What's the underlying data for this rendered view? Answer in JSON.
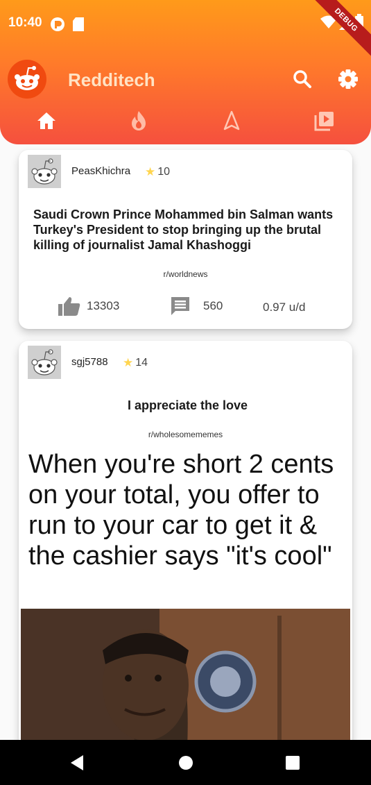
{
  "status_bar": {
    "time": "10:40",
    "debug_label": "DEBUG"
  },
  "header": {
    "title": "Redditech",
    "logo_icon": "reddit-snoo-icon",
    "actions": [
      "search-icon",
      "gear-icon"
    ]
  },
  "tabs": [
    {
      "icon": "home-icon",
      "active": true
    },
    {
      "icon": "fire-icon",
      "active": false
    },
    {
      "icon": "navigation-arrow-icon",
      "active": false
    },
    {
      "icon": "video-library-icon",
      "active": false
    }
  ],
  "posts": [
    {
      "author": "PeasKhichra",
      "karma": "10",
      "title": "Saudi Crown Prince Mohammed bin Salman wants Turkey's President to stop bringing up the brutal killing of journalist Jamal Khashoggi",
      "subreddit": "r/worldnews",
      "upvotes": "13303",
      "comments": "560",
      "rate": "0.97 u/d"
    },
    {
      "author": "sgj5788",
      "karma": "14",
      "title": "I appreciate the love",
      "subreddit": "r/wholesomememes",
      "meme_text": "When you're short 2 cents on your total, you offer to run to your car to get it & the cashier says \"it's cool\""
    }
  ],
  "colors": {
    "header_gradient_top": "#ff9a1a",
    "header_gradient_bottom": "#f5503e",
    "star": "#ffd54f",
    "card_bg": "#ffffff"
  }
}
